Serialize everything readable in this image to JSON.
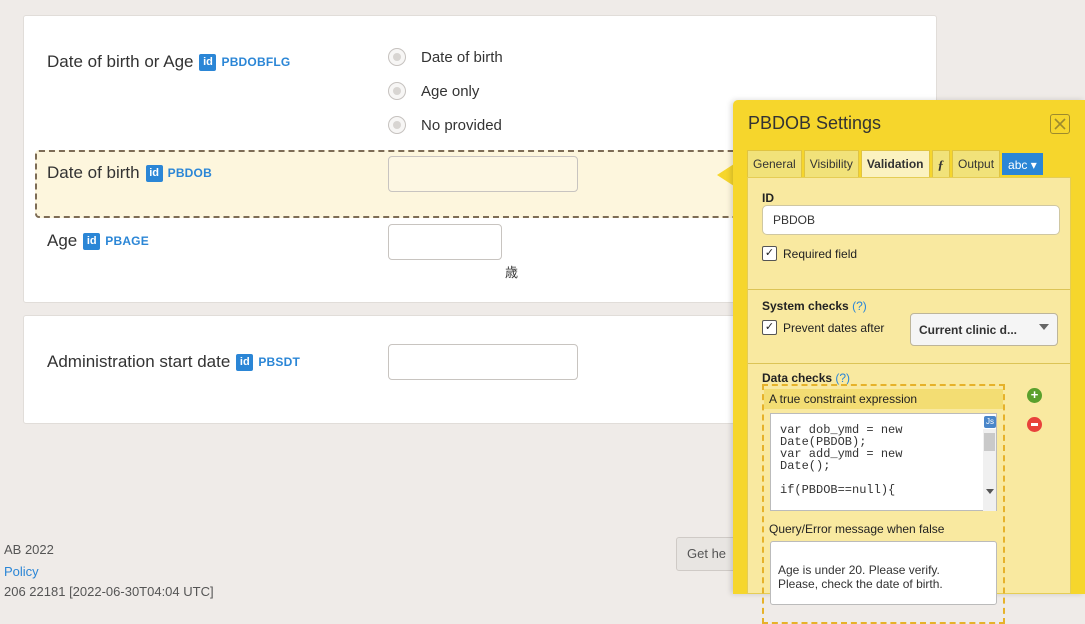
{
  "form": {
    "dob_or_age": {
      "label": "Date of birth or Age",
      "id_badge": "id",
      "id_name": "PBDOBFLG",
      "options": [
        "Date of birth",
        "Age only",
        "No provided"
      ]
    },
    "dob": {
      "label": "Date of birth",
      "id_badge": "id",
      "id_name": "PBDOB"
    },
    "age": {
      "label": "Age",
      "id_badge": "id",
      "id_name": "PBAGE",
      "unit": "歳"
    },
    "start_date": {
      "label": "Administration start date",
      "id_badge": "id",
      "id_name": "PBSDT"
    }
  },
  "footer": {
    "copyright": "AB 2022",
    "policy_link": "Policy",
    "version": "206 22181 [2022-06-30T04:04 UTC]",
    "help_button": "Get he"
  },
  "panel": {
    "title": "PBDOB Settings",
    "tabs": [
      "General",
      "Visibility",
      "Validation",
      "ƒ",
      "Output",
      "abc ▾"
    ],
    "active_tab": "Validation",
    "id_label": "ID",
    "id_value": "PBDOB",
    "required_label": "Required field",
    "system_checks_label": "System checks",
    "help_marker": "(?)",
    "prevent_dates_label": "Prevent dates after",
    "prevent_dates_select": "Current clinic d...",
    "data_checks_label": "Data checks",
    "constraint_label": "A true constraint expression",
    "code": "var dob_ymd = new\nDate(PBDOB);\nvar add_ymd = new\nDate();\n\nif(PBDOB==null){",
    "js_badge": "Js",
    "error_label": "Query/Error message when false",
    "error_message": "Age is under 20. Please verify.\nPlease, check the date of birth."
  }
}
